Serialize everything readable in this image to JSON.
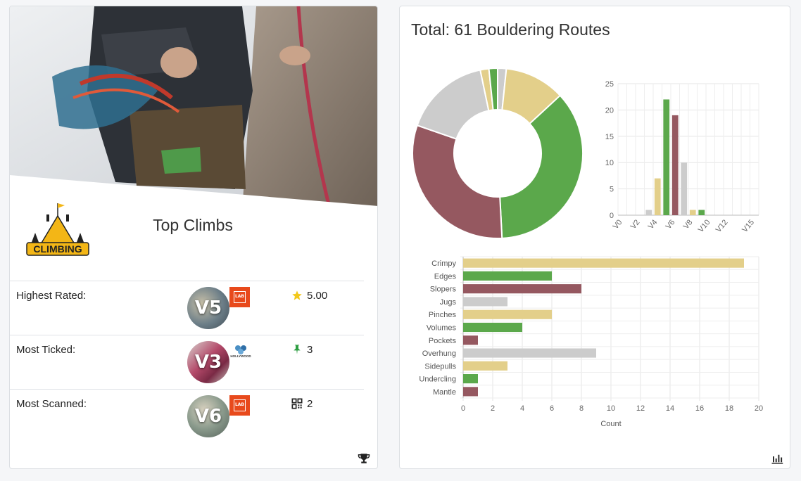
{
  "left_card": {
    "logo_text": "CLIMBING",
    "title": "Top Climbs",
    "rows": [
      {
        "label": "Highest Rated:",
        "grade": "V5",
        "gym_badge": "LAB",
        "stat_icon": "star-icon",
        "stat_value": "5.00"
      },
      {
        "label": "Most Ticked:",
        "grade": "V3",
        "gym_badge": "HOLLYWOOD",
        "stat_icon": "pin-icon",
        "stat_value": "3"
      },
      {
        "label": "Most Scanned:",
        "grade": "V6",
        "gym_badge": "LAB",
        "stat_icon": "qr-code-icon",
        "stat_value": "2"
      }
    ],
    "footer_icon": "trophy-icon"
  },
  "right_card": {
    "title": "Total: 61 Bouldering Routes",
    "footer_icon": "bar-chart-icon"
  },
  "colors": {
    "yellow": "#e3cf8a",
    "green": "#5ba84b",
    "maroon": "#955860",
    "gray": "#cccccc",
    "star": "#f2c81b",
    "pin": "#2e9e42",
    "badge": "#e84a1c"
  },
  "chart_data": [
    {
      "type": "pie",
      "variant": "doughnut",
      "categories": [
        "V0",
        "V1",
        "V2",
        "V3",
        "V4",
        "V5",
        "V6",
        "V7",
        "V8",
        "V9",
        "V10",
        "V11",
        "V12",
        "V13",
        "V14",
        "V15"
      ],
      "values": [
        0,
        0,
        0,
        1,
        7,
        22,
        19,
        10,
        1,
        1,
        0,
        0,
        0,
        0,
        0,
        0
      ],
      "colors": [
        "#e3cf8a",
        "#5ba84b",
        "#955860",
        "#cccccc",
        "#e3cf8a",
        "#5ba84b",
        "#955860",
        "#cccccc",
        "#e3cf8a",
        "#5ba84b",
        "#955860",
        "#cccccc",
        "#e3cf8a",
        "#5ba84b",
        "#955860",
        "#cccccc"
      ]
    },
    {
      "type": "bar",
      "categories": [
        "V0",
        "V1",
        "V2",
        "V3",
        "V4",
        "V5",
        "V6",
        "V7",
        "V8",
        "V9",
        "V10",
        "V11",
        "V12",
        "V13",
        "V14",
        "V15"
      ],
      "tick_labels": [
        "V0",
        "V2",
        "V4",
        "V6",
        "V8",
        "V10",
        "V12",
        "V15"
      ],
      "values": [
        0,
        0,
        0,
        1,
        7,
        22,
        19,
        10,
        1,
        1,
        0,
        0,
        0,
        0,
        0,
        0
      ],
      "ylim": [
        0,
        25
      ],
      "yticks": [
        0,
        5,
        10,
        15,
        20,
        25
      ],
      "grid": true
    },
    {
      "type": "bar",
      "orientation": "horizontal",
      "categories": [
        "Crimpy",
        "Edges",
        "Slopers",
        "Jugs",
        "Pinches",
        "Volumes",
        "Pockets",
        "Overhung",
        "Sidepulls",
        "Undercling",
        "Mantle"
      ],
      "values": [
        19,
        6,
        8,
        3,
        6,
        4,
        1,
        9,
        3,
        1,
        1
      ],
      "xlabel": "Count",
      "xlim": [
        0,
        20
      ],
      "xticks": [
        0,
        2,
        4,
        6,
        8,
        10,
        12,
        14,
        16,
        18,
        20
      ],
      "grid": true
    }
  ]
}
